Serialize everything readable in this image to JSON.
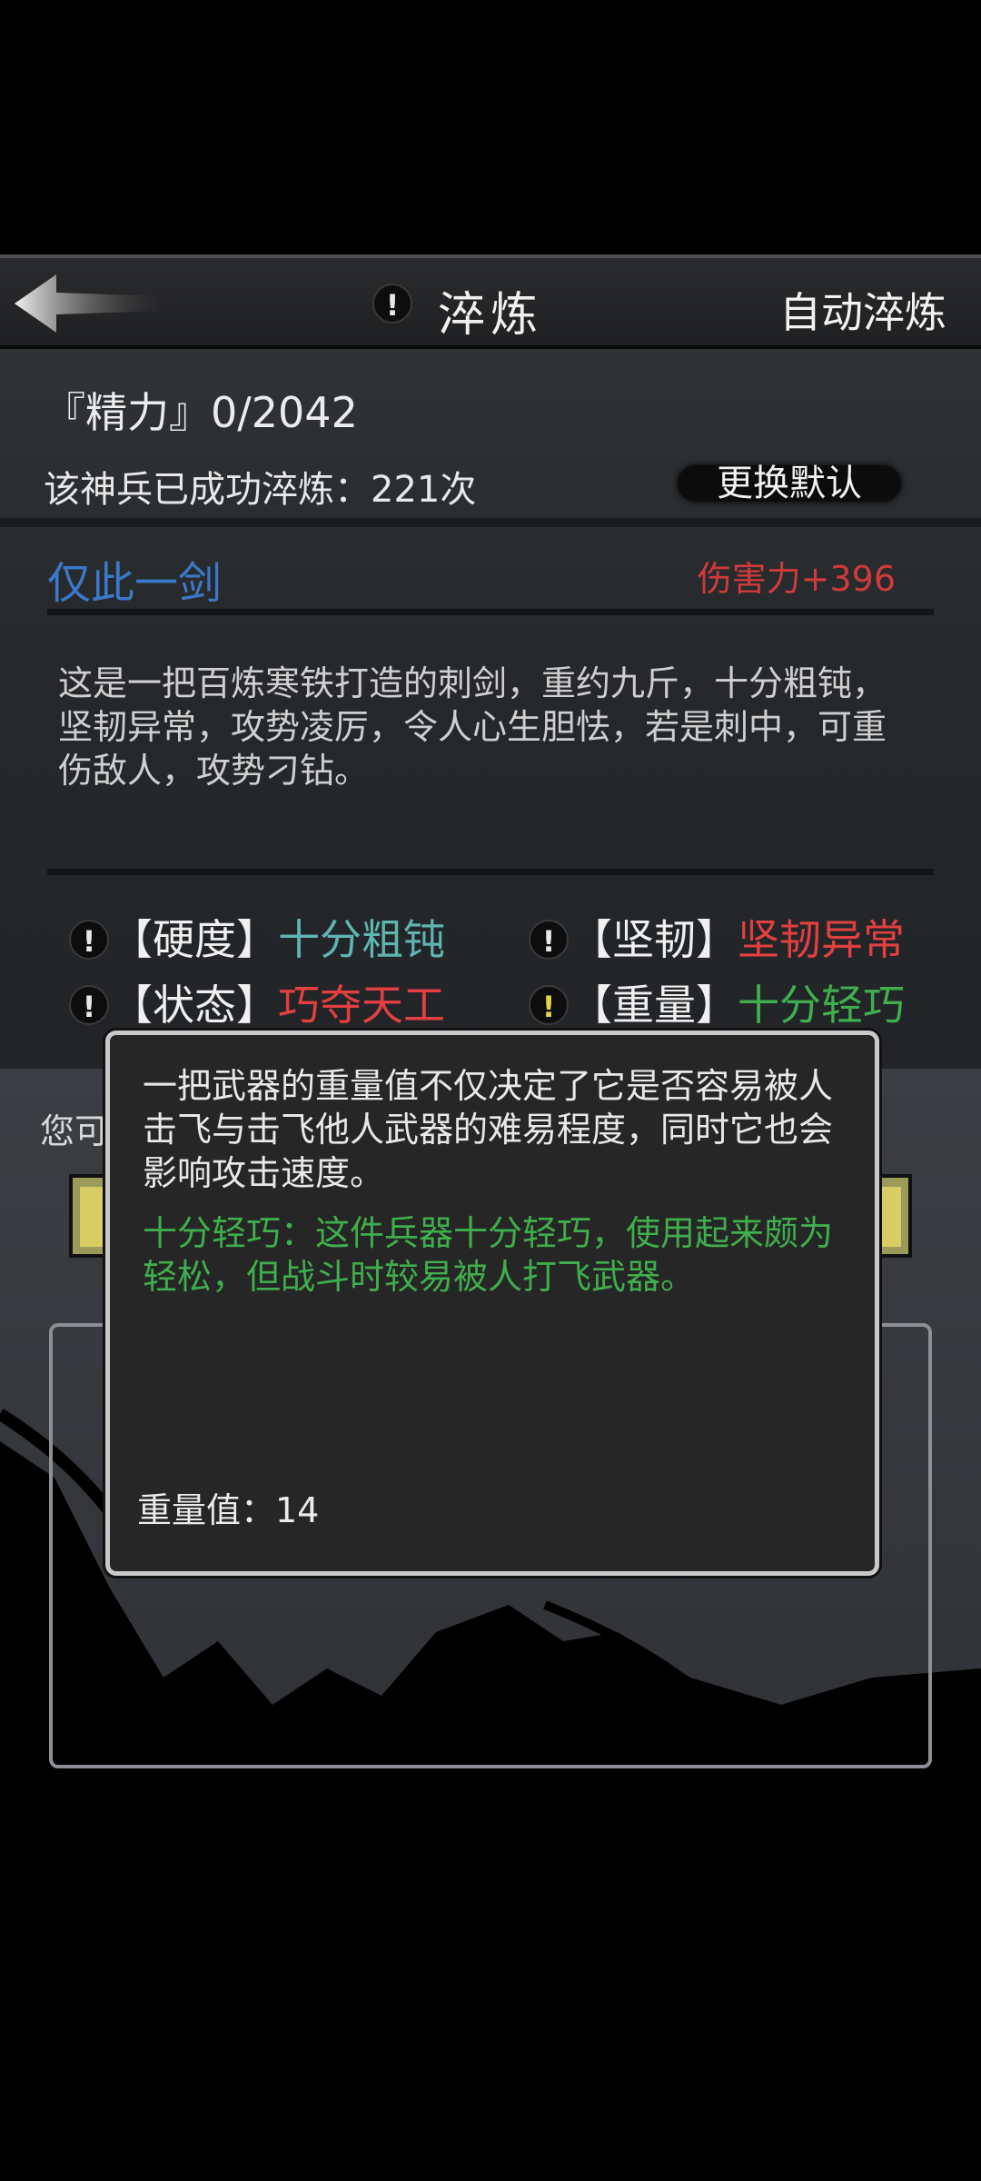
{
  "header": {
    "title": "淬炼",
    "auto_refine_label": "自动淬炼",
    "info_glyph": "!"
  },
  "status": {
    "energy": "『精力』0/2042",
    "success_count": "该神兵已成功淬炼：221次",
    "change_default_label": "更换默认"
  },
  "weapon": {
    "name": "仅此一剑",
    "damage": "伤害力+396",
    "description": "这是一把百炼寒铁打造的刺剑，重约九斤，十分粗钝，坚韧异常，攻势凌厉，令人心生胆怯，若是刺中，可重伤敌人，攻势刁钻。"
  },
  "attributes": [
    {
      "label": "【硬度】",
      "value": "十分粗钝",
      "color": "#5fb5b0",
      "icon": "info-icon"
    },
    {
      "label": "【坚韧】",
      "value": "坚韧异常",
      "color": "#e24040",
      "icon": "info-icon"
    },
    {
      "label": "【状态】",
      "value": "巧夺天工",
      "color": "#e24040",
      "icon": "info-icon"
    },
    {
      "label": "【重量】",
      "value": "十分轻巧",
      "color": "#3fae4c",
      "icon": "info-icon-highlighted"
    }
  ],
  "lower": {
    "hint_partial": "您可"
  },
  "popup": {
    "description": "一把武器的重量值不仅决定了它是否容易被人击飞与击飞他人武器的难易程度，同时它也会影响攻击速度。",
    "effect": "十分轻巧：这件兵器十分轻巧，使用起来颇为轻松，但战斗时较易被人打飞武器。",
    "weight_value": "重量值：14"
  },
  "colors": {
    "name_blue": "#3c78c8",
    "damage_red": "#d23a3a",
    "effect_green": "#3fae4c",
    "highlight_yellow": "#e3d64a"
  }
}
